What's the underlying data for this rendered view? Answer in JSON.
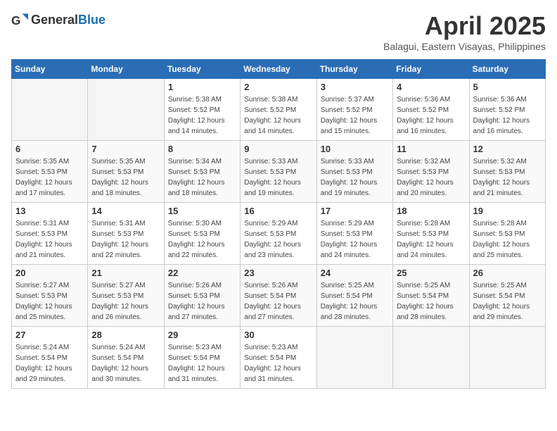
{
  "header": {
    "logo_general": "General",
    "logo_blue": "Blue",
    "month": "April 2025",
    "location": "Balagui, Eastern Visayas, Philippines"
  },
  "days_of_week": [
    "Sunday",
    "Monday",
    "Tuesday",
    "Wednesday",
    "Thursday",
    "Friday",
    "Saturday"
  ],
  "weeks": [
    [
      {
        "day": "",
        "empty": true
      },
      {
        "day": "",
        "empty": true
      },
      {
        "day": "1",
        "sunrise": "Sunrise: 5:38 AM",
        "sunset": "Sunset: 5:52 PM",
        "daylight": "Daylight: 12 hours and 14 minutes."
      },
      {
        "day": "2",
        "sunrise": "Sunrise: 5:38 AM",
        "sunset": "Sunset: 5:52 PM",
        "daylight": "Daylight: 12 hours and 14 minutes."
      },
      {
        "day": "3",
        "sunrise": "Sunrise: 5:37 AM",
        "sunset": "Sunset: 5:52 PM",
        "daylight": "Daylight: 12 hours and 15 minutes."
      },
      {
        "day": "4",
        "sunrise": "Sunrise: 5:36 AM",
        "sunset": "Sunset: 5:52 PM",
        "daylight": "Daylight: 12 hours and 16 minutes."
      },
      {
        "day": "5",
        "sunrise": "Sunrise: 5:36 AM",
        "sunset": "Sunset: 5:52 PM",
        "daylight": "Daylight: 12 hours and 16 minutes."
      }
    ],
    [
      {
        "day": "6",
        "sunrise": "Sunrise: 5:35 AM",
        "sunset": "Sunset: 5:53 PM",
        "daylight": "Daylight: 12 hours and 17 minutes."
      },
      {
        "day": "7",
        "sunrise": "Sunrise: 5:35 AM",
        "sunset": "Sunset: 5:53 PM",
        "daylight": "Daylight: 12 hours and 18 minutes."
      },
      {
        "day": "8",
        "sunrise": "Sunrise: 5:34 AM",
        "sunset": "Sunset: 5:53 PM",
        "daylight": "Daylight: 12 hours and 18 minutes."
      },
      {
        "day": "9",
        "sunrise": "Sunrise: 5:33 AM",
        "sunset": "Sunset: 5:53 PM",
        "daylight": "Daylight: 12 hours and 19 minutes."
      },
      {
        "day": "10",
        "sunrise": "Sunrise: 5:33 AM",
        "sunset": "Sunset: 5:53 PM",
        "daylight": "Daylight: 12 hours and 19 minutes."
      },
      {
        "day": "11",
        "sunrise": "Sunrise: 5:32 AM",
        "sunset": "Sunset: 5:53 PM",
        "daylight": "Daylight: 12 hours and 20 minutes."
      },
      {
        "day": "12",
        "sunrise": "Sunrise: 5:32 AM",
        "sunset": "Sunset: 5:53 PM",
        "daylight": "Daylight: 12 hours and 21 minutes."
      }
    ],
    [
      {
        "day": "13",
        "sunrise": "Sunrise: 5:31 AM",
        "sunset": "Sunset: 5:53 PM",
        "daylight": "Daylight: 12 hours and 21 minutes."
      },
      {
        "day": "14",
        "sunrise": "Sunrise: 5:31 AM",
        "sunset": "Sunset: 5:53 PM",
        "daylight": "Daylight: 12 hours and 22 minutes."
      },
      {
        "day": "15",
        "sunrise": "Sunrise: 5:30 AM",
        "sunset": "Sunset: 5:53 PM",
        "daylight": "Daylight: 12 hours and 22 minutes."
      },
      {
        "day": "16",
        "sunrise": "Sunrise: 5:29 AM",
        "sunset": "Sunset: 5:53 PM",
        "daylight": "Daylight: 12 hours and 23 minutes."
      },
      {
        "day": "17",
        "sunrise": "Sunrise: 5:29 AM",
        "sunset": "Sunset: 5:53 PM",
        "daylight": "Daylight: 12 hours and 24 minutes."
      },
      {
        "day": "18",
        "sunrise": "Sunrise: 5:28 AM",
        "sunset": "Sunset: 5:53 PM",
        "daylight": "Daylight: 12 hours and 24 minutes."
      },
      {
        "day": "19",
        "sunrise": "Sunrise: 5:28 AM",
        "sunset": "Sunset: 5:53 PM",
        "daylight": "Daylight: 12 hours and 25 minutes."
      }
    ],
    [
      {
        "day": "20",
        "sunrise": "Sunrise: 5:27 AM",
        "sunset": "Sunset: 5:53 PM",
        "daylight": "Daylight: 12 hours and 25 minutes."
      },
      {
        "day": "21",
        "sunrise": "Sunrise: 5:27 AM",
        "sunset": "Sunset: 5:53 PM",
        "daylight": "Daylight: 12 hours and 26 minutes."
      },
      {
        "day": "22",
        "sunrise": "Sunrise: 5:26 AM",
        "sunset": "Sunset: 5:53 PM",
        "daylight": "Daylight: 12 hours and 27 minutes."
      },
      {
        "day": "23",
        "sunrise": "Sunrise: 5:26 AM",
        "sunset": "Sunset: 5:54 PM",
        "daylight": "Daylight: 12 hours and 27 minutes."
      },
      {
        "day": "24",
        "sunrise": "Sunrise: 5:25 AM",
        "sunset": "Sunset: 5:54 PM",
        "daylight": "Daylight: 12 hours and 28 minutes."
      },
      {
        "day": "25",
        "sunrise": "Sunrise: 5:25 AM",
        "sunset": "Sunset: 5:54 PM",
        "daylight": "Daylight: 12 hours and 28 minutes."
      },
      {
        "day": "26",
        "sunrise": "Sunrise: 5:25 AM",
        "sunset": "Sunset: 5:54 PM",
        "daylight": "Daylight: 12 hours and 29 minutes."
      }
    ],
    [
      {
        "day": "27",
        "sunrise": "Sunrise: 5:24 AM",
        "sunset": "Sunset: 5:54 PM",
        "daylight": "Daylight: 12 hours and 29 minutes."
      },
      {
        "day": "28",
        "sunrise": "Sunrise: 5:24 AM",
        "sunset": "Sunset: 5:54 PM",
        "daylight": "Daylight: 12 hours and 30 minutes."
      },
      {
        "day": "29",
        "sunrise": "Sunrise: 5:23 AM",
        "sunset": "Sunset: 5:54 PM",
        "daylight": "Daylight: 12 hours and 31 minutes."
      },
      {
        "day": "30",
        "sunrise": "Sunrise: 5:23 AM",
        "sunset": "Sunset: 5:54 PM",
        "daylight": "Daylight: 12 hours and 31 minutes."
      },
      {
        "day": "",
        "empty": true
      },
      {
        "day": "",
        "empty": true
      },
      {
        "day": "",
        "empty": true
      }
    ]
  ]
}
